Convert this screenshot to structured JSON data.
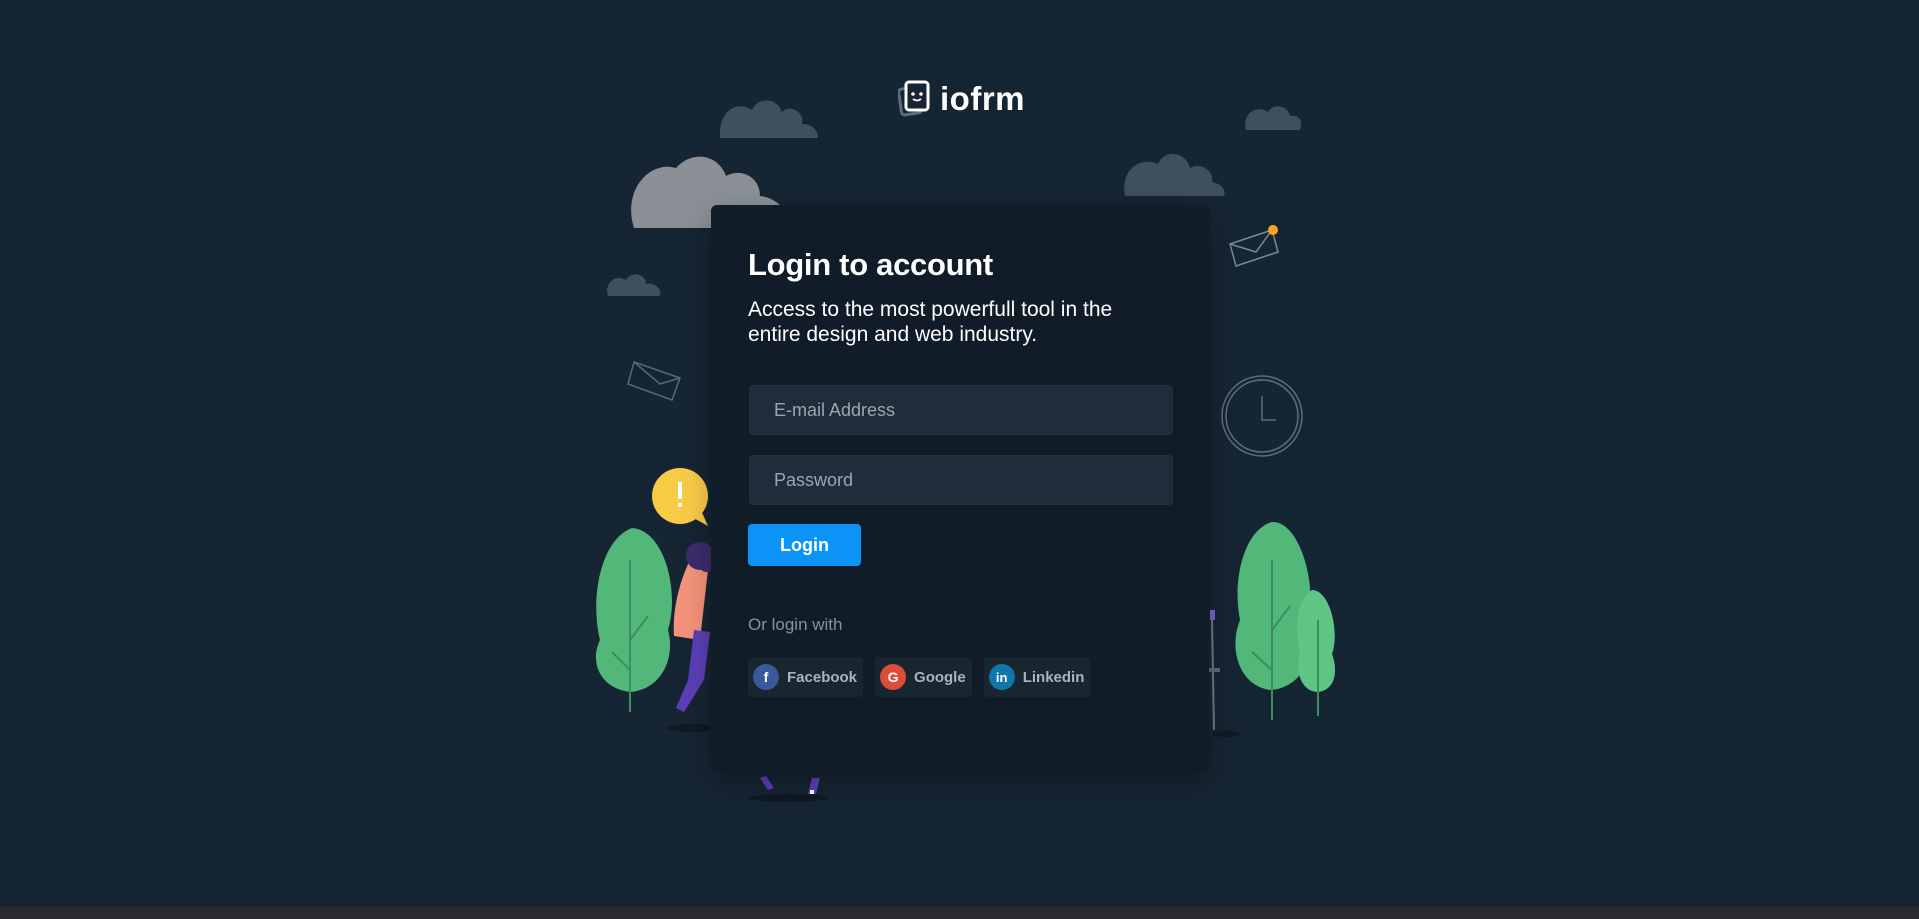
{
  "brand": {
    "name": "iofrm"
  },
  "login": {
    "title": "Login to account",
    "subtitle": "Access to the most powerfull tool in the entire design and web industry.",
    "email_placeholder": "E-mail Address",
    "password_placeholder": "Password",
    "submit_label": "Login",
    "or_label": "Or login with",
    "socials": [
      {
        "label": "Facebook",
        "icon": "facebook-icon",
        "color": "#3b5998"
      },
      {
        "label": "Google",
        "icon": "google-icon",
        "color": "#dd4b39"
      },
      {
        "label": "Linkedin",
        "icon": "linkedin-icon",
        "color": "#0e76a8"
      }
    ]
  },
  "colors": {
    "background": "#162533",
    "card": "#101c27",
    "accent": "#0b93f6",
    "field": "#1e2d39"
  }
}
